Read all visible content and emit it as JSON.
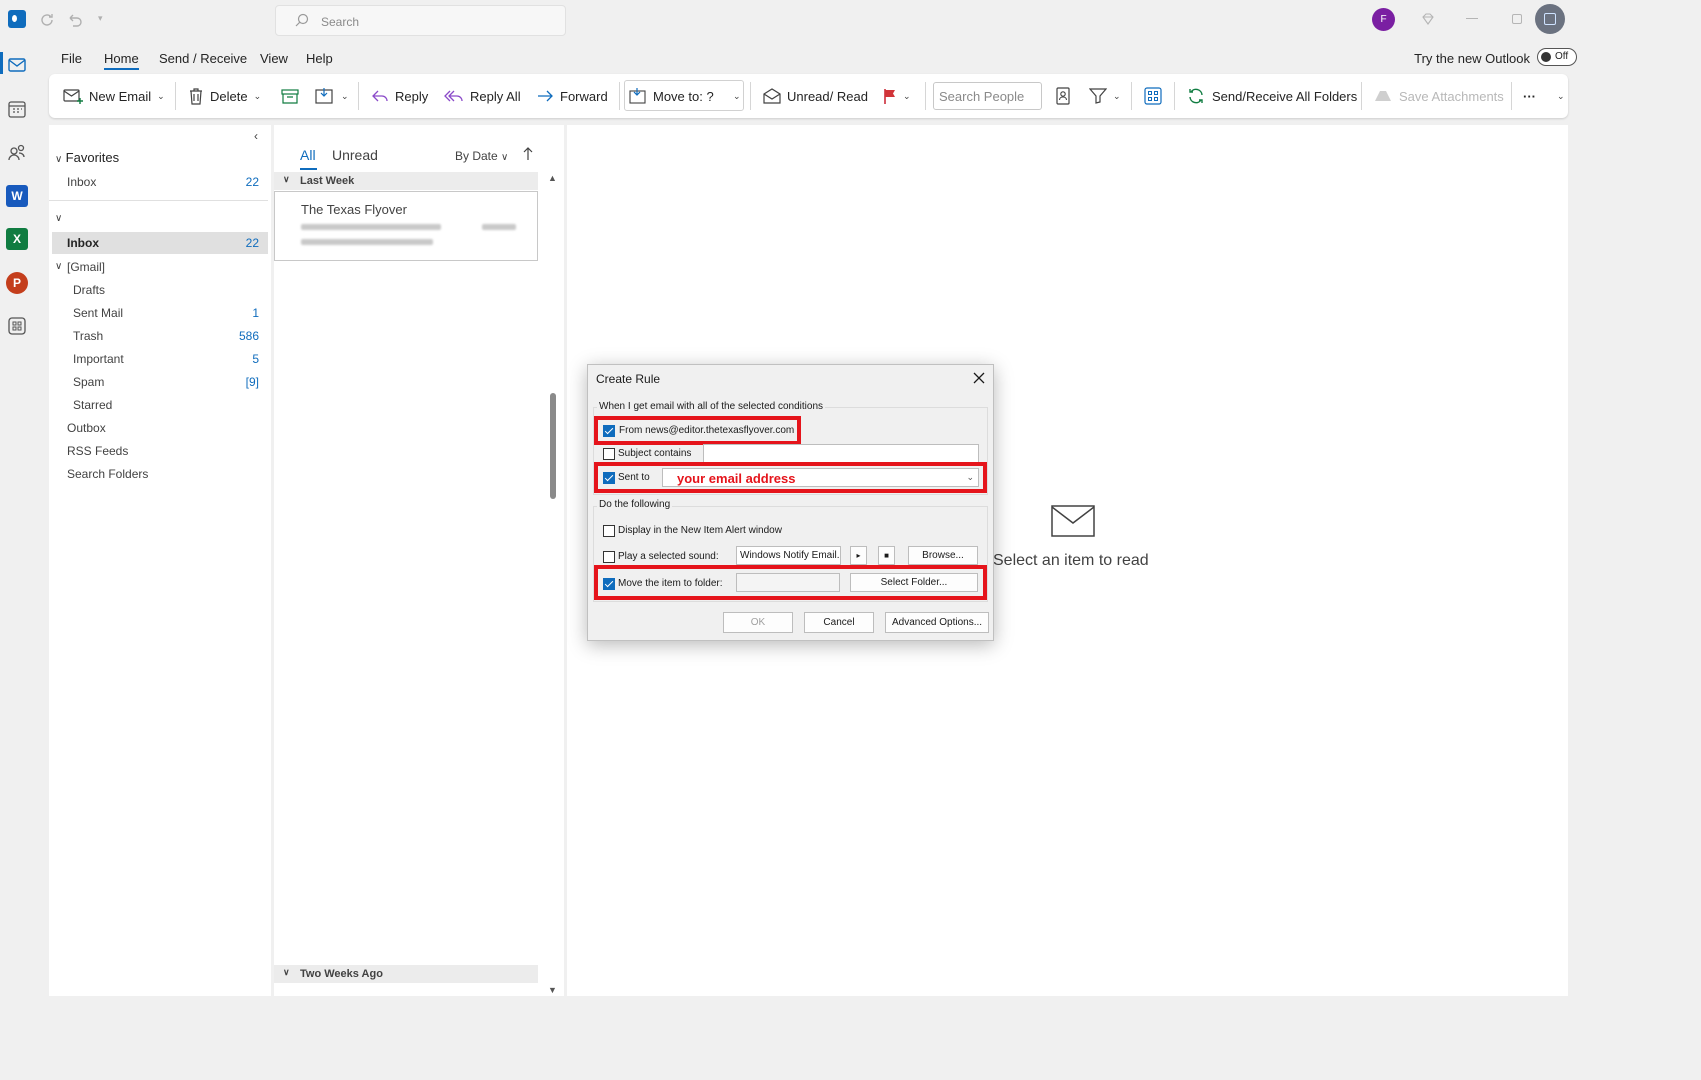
{
  "titlebar": {
    "search_placeholder": "Search",
    "avatar_initial": "F"
  },
  "menu": {
    "items": [
      "File",
      "Home",
      "Send / Receive",
      "View",
      "Help"
    ],
    "active": "Home",
    "try_new_outlook": "Try the new Outlook",
    "toggle_label": "Off"
  },
  "ribbon": {
    "new_email": "New Email",
    "delete": "Delete",
    "reply": "Reply",
    "reply_all": "Reply All",
    "forward": "Forward",
    "move_to": "Move to: ?",
    "unread_read": "Unread/ Read",
    "search_people_placeholder": "Search People",
    "send_receive_all": "Send/Receive All Folders",
    "save_attachments": "Save Attachments",
    "more": "···"
  },
  "folders": {
    "favorites_label": "Favorites",
    "favorites": [
      {
        "label": "Inbox",
        "count": "22"
      }
    ],
    "account": [
      {
        "label": "Inbox",
        "count": "22",
        "selected": true
      },
      {
        "label": "[Gmail]",
        "count": ""
      },
      {
        "label": "Drafts",
        "count": ""
      },
      {
        "label": "Sent Mail",
        "count": "1"
      },
      {
        "label": "Trash",
        "count": "586"
      },
      {
        "label": "Important",
        "count": "5"
      },
      {
        "label": "Spam",
        "count": "[9]"
      },
      {
        "label": "Starred",
        "count": ""
      },
      {
        "label": "Outbox",
        "count": ""
      },
      {
        "label": "RSS Feeds",
        "count": ""
      },
      {
        "label": "Search Folders",
        "count": ""
      }
    ]
  },
  "message_list": {
    "tab_all": "All",
    "tab_unread": "Unread",
    "sort_label": "By Date",
    "groups": [
      "Last Week",
      "Two Weeks Ago"
    ],
    "messages": [
      {
        "sender": "The Texas Flyover"
      }
    ]
  },
  "reading_pane": {
    "empty_text": "Select an item to read"
  },
  "dialog": {
    "title": "Create Rule",
    "conditions_legend": "When I get email with all of the selected conditions",
    "from_label": "From news@editor.thetexasflyover.com",
    "from_checked": true,
    "subject_label": "Subject contains",
    "subject_checked": false,
    "subject_value": "",
    "sent_to_label": "Sent to",
    "sent_to_checked": true,
    "sent_to_value": "your email address",
    "actions_legend": "Do the following",
    "display_alert_label": "Display in the New Item Alert window",
    "display_alert_checked": false,
    "play_sound_label": "Play a selected sound:",
    "play_sound_checked": false,
    "sound_value": "Windows Notify Email.",
    "browse_label": "Browse...",
    "move_label": "Move the item to folder:",
    "move_checked": true,
    "move_value": "",
    "select_folder_label": "Select Folder...",
    "ok_label": "OK",
    "cancel_label": "Cancel",
    "advanced_label": "Advanced Options..."
  },
  "colors": {
    "accent": "#0f6cbd",
    "highlight": "#e5141b",
    "avatar": "#7a1fa2"
  }
}
